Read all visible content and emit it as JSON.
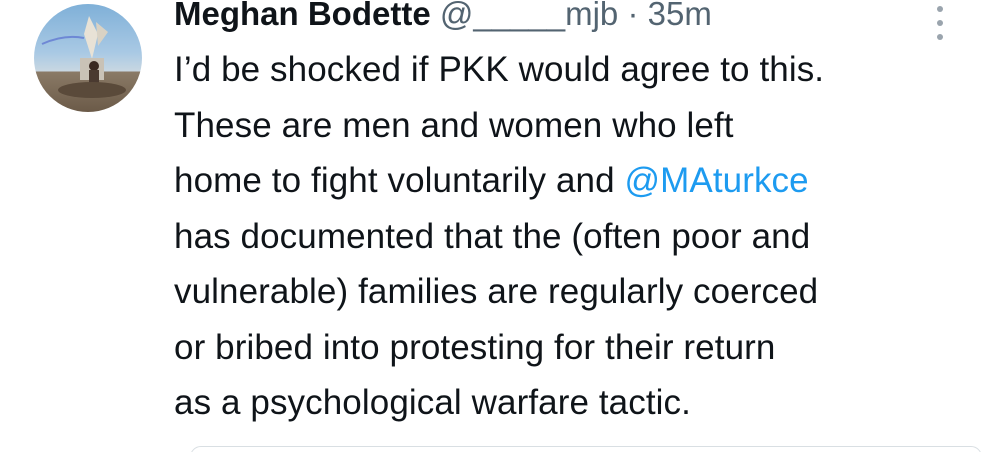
{
  "tweet": {
    "author_name": "Meghan Bodette",
    "handle": "@_____mjb",
    "separator": "·",
    "time": "35m",
    "more_icon": "more-vertical-icon",
    "avatar_icon": "avatar",
    "lines": [
      "I’d be shocked if PKK would agree to this.",
      "These are men and women who left",
      "home to fight voluntarily and ",
      "has documented that the (often poor and",
      "vulnerable) families are regularly coerced",
      "or bribed into protesting for their return",
      "as a psychological warfare tactic."
    ],
    "mention": "@MAturkce",
    "colors": {
      "text": "#0f1419",
      "secondary": "#536471",
      "link": "#1d9bf0"
    }
  }
}
